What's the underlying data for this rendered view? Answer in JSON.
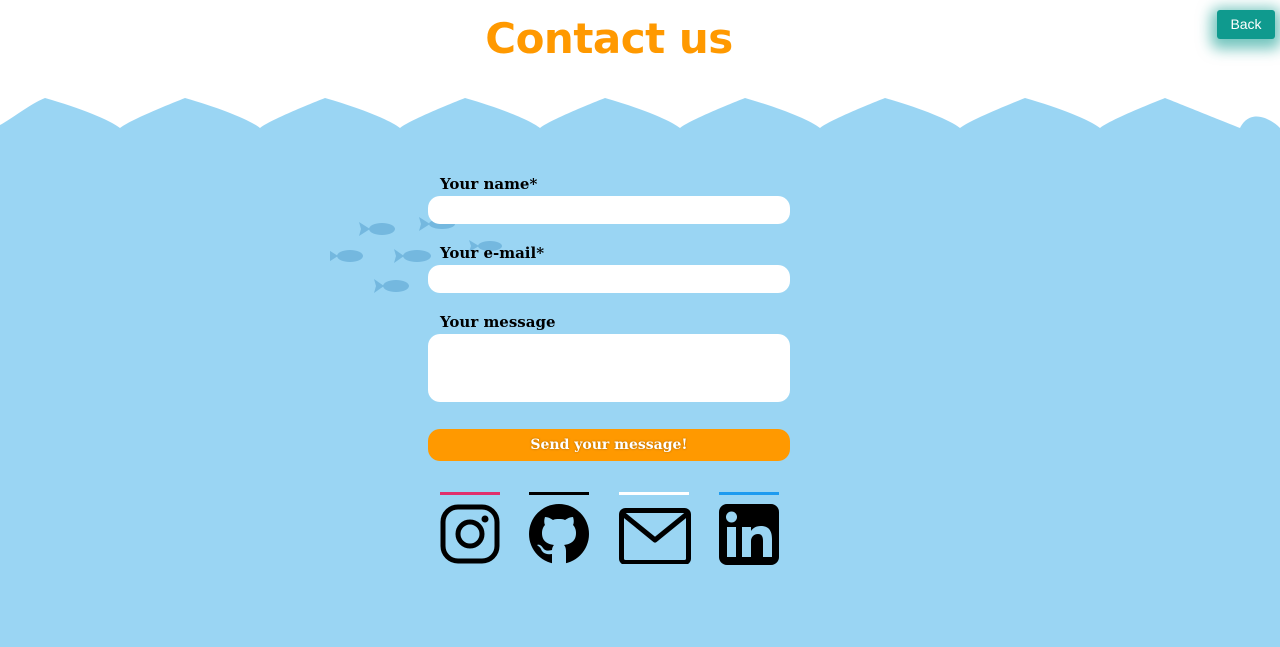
{
  "header": {
    "title": "Contact us",
    "back_label": "Back"
  },
  "form": {
    "name_label": "Your name*",
    "name_value": "",
    "email_label": "Your e-mail*",
    "email_value": "",
    "message_label": "Your message",
    "message_value": "",
    "submit_label": "Send your message!"
  },
  "socials": [
    {
      "name": "instagram",
      "icon": "instagram-icon",
      "accent": "#e1306c"
    },
    {
      "name": "github",
      "icon": "github-icon",
      "accent": "#000000"
    },
    {
      "name": "email",
      "icon": "mail-icon",
      "accent": "#ffffff"
    },
    {
      "name": "linkedin",
      "icon": "linkedin-icon",
      "accent": "#1d9bf0"
    }
  ],
  "colors": {
    "background": "#9ad5f3",
    "accent_orange": "#ff9900",
    "back_button": "#0f9a8e",
    "fish": "#74b8df"
  }
}
